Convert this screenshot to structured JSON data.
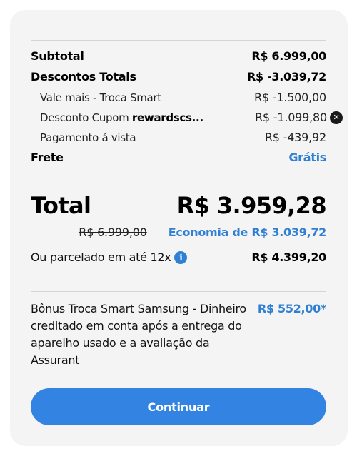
{
  "summary": {
    "subtotal_label": "Subtotal",
    "subtotal_value": "R$ 6.999,00",
    "discounts_label": "Descontos Totais",
    "discounts_value": "R$ -3.039,72",
    "discount_items": [
      {
        "label": "Vale mais - Troca Smart",
        "value": "R$ -1.500,00"
      },
      {
        "label": "Desconto Cupom ",
        "code": "rewardscs...",
        "value": "R$ -1.099,80"
      },
      {
        "label": "Pagamento á vista",
        "value": "R$ -439,92"
      }
    ],
    "shipping_label": "Frete",
    "shipping_value": "Grátis"
  },
  "total": {
    "label": "Total",
    "value": "R$ 3.959,28",
    "original_price": "R$ 6.999,00",
    "economy": "Economia de R$ 3.039,72"
  },
  "installments": {
    "label": "Ou parcelado em até 12x",
    "info_icon": "info-icon",
    "value": "R$ 4.399,20"
  },
  "bonus": {
    "text": "Bônus Troca Smart Samsung - Dinheiro creditado em conta após a entrega do aparelho usado e a avaliação da Assurant",
    "value": "R$ 552,00*"
  },
  "actions": {
    "continue_label": "Continuar"
  },
  "colors": {
    "accent": "#2f7fd3",
    "button": "#3383e2",
    "card_background": "#f4f4f4"
  }
}
